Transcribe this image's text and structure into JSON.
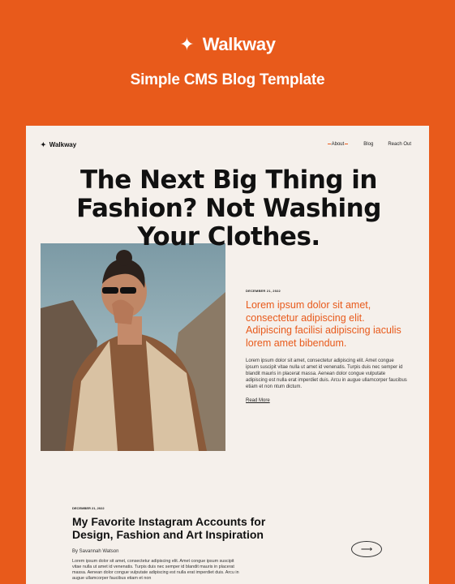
{
  "brand": {
    "star": "✦",
    "name": "Walkway",
    "tagline": "Simple CMS Blog Template"
  },
  "site": {
    "logo_star": "✦",
    "logo_text": "Walkway",
    "nav": [
      {
        "label": "About",
        "active": true
      },
      {
        "label": "Blog",
        "active": false
      },
      {
        "label": "Reach Out",
        "active": false
      }
    ]
  },
  "hero": {
    "title": "The Next Big Thing in Fashion? Not Washing Your Clothes."
  },
  "featured_post": {
    "date": "DECEMBER 21, 2022",
    "lead": "Lorem ipsum dolor sit amet, consectetur adipiscing elit. Adipiscing facilisi adipiscing iaculis lorem amet bibendum.",
    "body": "Lorem ipsum dolor sit amet, consectetur adipiscing elit. Amet congue ipsum suscipit vitae nulla ut amet id venenatis. Turpis duis nec semper id blandit mauris in placerat massa. Aenean dolor congue vulputate adipiscing est nulla erat imperdiet duis. Arcu in augue ullamcorper faucibus etiam et non ntum dictum.",
    "read_more": "Read More"
  },
  "second_post": {
    "date": "DECEMBER 21, 2022",
    "title": "My Favorite Instagram Accounts for Design, Fashion and Art Inspiration",
    "author": "By Savannah Watson",
    "body": "Lorem ipsum dolor sit amet, consectetur adipiscing elit. Amet congue ipsum suscipit vitae nulla ut amet id venenatis. Turpis duis nec semper id blandit mauris in placerat massa. Aenean dolor congue vulputate adipiscing est nulla erat imperdiet duis. Arcu in augue ullamcorper faucibus etiam et non",
    "arrow": "⟶"
  },
  "colors": {
    "accent": "#E85A1B",
    "card_bg": "#F5F0EB",
    "text": "#111111"
  }
}
